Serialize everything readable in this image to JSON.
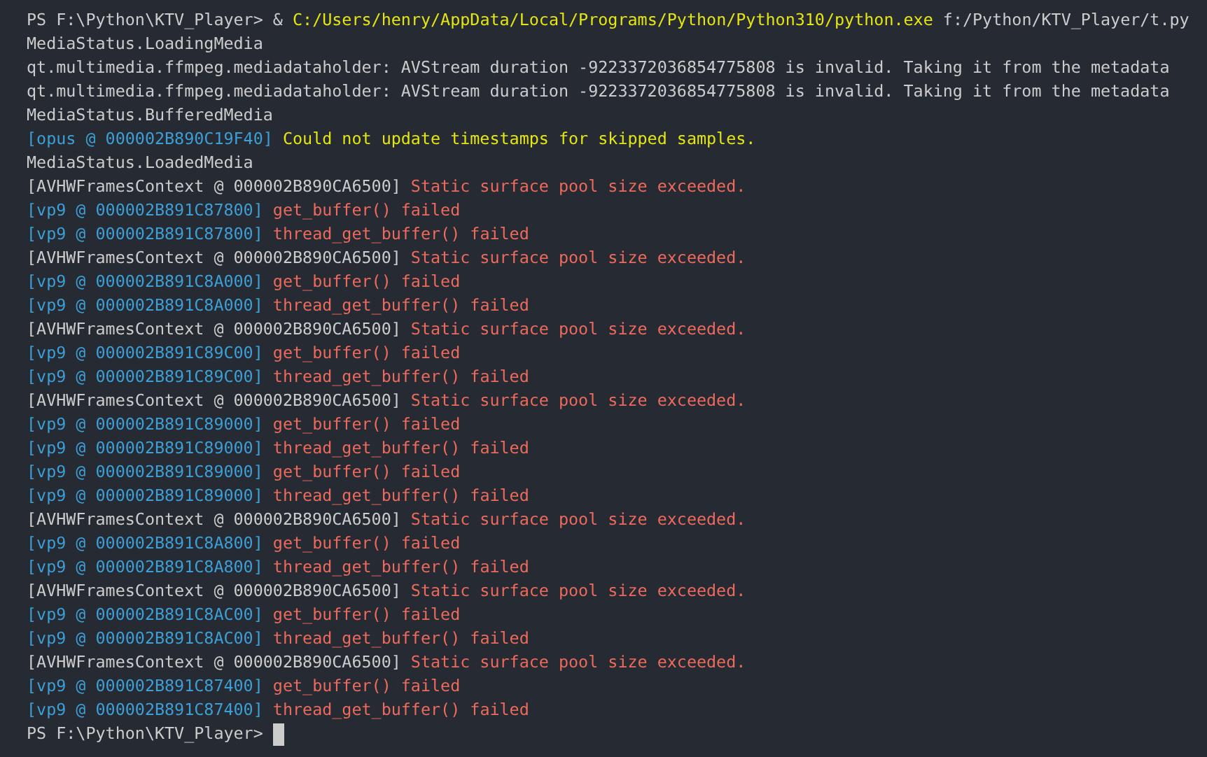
{
  "lines": [
    {
      "segments": [
        {
          "kind": "plain",
          "text": "PS F:\\Python\\KTV_Player>"
        },
        {
          "kind": "plain",
          "text": "&"
        },
        {
          "kind": "path",
          "text": "C:/Users/henry/AppData/Local/Programs/Python/Python310/python.exe"
        },
        {
          "kind": "plain",
          "text": "f:/Python/KTV_Player/t.py"
        }
      ]
    },
    {
      "segments": [
        {
          "kind": "plain",
          "text": "MediaStatus.LoadingMedia"
        }
      ]
    },
    {
      "segments": [
        {
          "kind": "plain",
          "text": "qt.multimedia.ffmpeg.mediadataholder: AVStream duration -9223372036854775808 is invalid. Taking it from the metadata"
        }
      ]
    },
    {
      "segments": [
        {
          "kind": "plain",
          "text": "qt.multimedia.ffmpeg.mediadataholder: AVStream duration -9223372036854775808 is invalid. Taking it from the metadata"
        }
      ]
    },
    {
      "segments": [
        {
          "kind": "plain",
          "text": "MediaStatus.BufferedMedia"
        }
      ]
    },
    {
      "segments": [
        {
          "kind": "source",
          "text": "[opus @ 000002B890C19F40]"
        },
        {
          "kind": "warning",
          "text": "Could not update timestamps for skipped samples."
        }
      ]
    },
    {
      "segments": [
        {
          "kind": "plain",
          "text": "MediaStatus.LoadedMedia"
        }
      ]
    },
    {
      "segments": [
        {
          "kind": "plain",
          "text": "[AVHWFramesContext @ 000002B890CA6500]"
        },
        {
          "kind": "error",
          "text": "Static surface pool size exceeded."
        }
      ]
    },
    {
      "segments": [
        {
          "kind": "source",
          "text": "[vp9 @ 000002B891C87800]"
        },
        {
          "kind": "error",
          "text": "get_buffer() failed"
        }
      ]
    },
    {
      "segments": [
        {
          "kind": "source",
          "text": "[vp9 @ 000002B891C87800]"
        },
        {
          "kind": "error",
          "text": "thread_get_buffer() failed"
        }
      ]
    },
    {
      "segments": [
        {
          "kind": "plain",
          "text": "[AVHWFramesContext @ 000002B890CA6500]"
        },
        {
          "kind": "error",
          "text": "Static surface pool size exceeded."
        }
      ]
    },
    {
      "segments": [
        {
          "kind": "source",
          "text": "[vp9 @ 000002B891C8A000]"
        },
        {
          "kind": "error",
          "text": "get_buffer() failed"
        }
      ]
    },
    {
      "segments": [
        {
          "kind": "source",
          "text": "[vp9 @ 000002B891C8A000]"
        },
        {
          "kind": "error",
          "text": "thread_get_buffer() failed"
        }
      ]
    },
    {
      "segments": [
        {
          "kind": "plain",
          "text": "[AVHWFramesContext @ 000002B890CA6500]"
        },
        {
          "kind": "error",
          "text": "Static surface pool size exceeded."
        }
      ]
    },
    {
      "segments": [
        {
          "kind": "source",
          "text": "[vp9 @ 000002B891C89C00]"
        },
        {
          "kind": "error",
          "text": "get_buffer() failed"
        }
      ]
    },
    {
      "segments": [
        {
          "kind": "source",
          "text": "[vp9 @ 000002B891C89C00]"
        },
        {
          "kind": "error",
          "text": "thread_get_buffer() failed"
        }
      ]
    },
    {
      "segments": [
        {
          "kind": "plain",
          "text": "[AVHWFramesContext @ 000002B890CA6500]"
        },
        {
          "kind": "error",
          "text": "Static surface pool size exceeded."
        }
      ]
    },
    {
      "segments": [
        {
          "kind": "source",
          "text": "[vp9 @ 000002B891C89000]"
        },
        {
          "kind": "error",
          "text": "get_buffer() failed"
        }
      ]
    },
    {
      "segments": [
        {
          "kind": "source",
          "text": "[vp9 @ 000002B891C89000]"
        },
        {
          "kind": "error",
          "text": "thread_get_buffer() failed"
        }
      ]
    },
    {
      "segments": [
        {
          "kind": "source",
          "text": "[vp9 @ 000002B891C89000]"
        },
        {
          "kind": "error",
          "text": "get_buffer() failed"
        }
      ]
    },
    {
      "segments": [
        {
          "kind": "source",
          "text": "[vp9 @ 000002B891C89000]"
        },
        {
          "kind": "error",
          "text": "thread_get_buffer() failed"
        }
      ]
    },
    {
      "segments": [
        {
          "kind": "plain",
          "text": "[AVHWFramesContext @ 000002B890CA6500]"
        },
        {
          "kind": "error",
          "text": "Static surface pool size exceeded."
        }
      ]
    },
    {
      "segments": [
        {
          "kind": "source",
          "text": "[vp9 @ 000002B891C8A800]"
        },
        {
          "kind": "error",
          "text": "get_buffer() failed"
        }
      ]
    },
    {
      "segments": [
        {
          "kind": "source",
          "text": "[vp9 @ 000002B891C8A800]"
        },
        {
          "kind": "error",
          "text": "thread_get_buffer() failed"
        }
      ]
    },
    {
      "segments": [
        {
          "kind": "plain",
          "text": "[AVHWFramesContext @ 000002B890CA6500]"
        },
        {
          "kind": "error",
          "text": "Static surface pool size exceeded."
        }
      ]
    },
    {
      "segments": [
        {
          "kind": "source",
          "text": "[vp9 @ 000002B891C8AC00]"
        },
        {
          "kind": "error",
          "text": "get_buffer() failed"
        }
      ]
    },
    {
      "segments": [
        {
          "kind": "source",
          "text": "[vp9 @ 000002B891C8AC00]"
        },
        {
          "kind": "error",
          "text": "thread_get_buffer() failed"
        }
      ]
    },
    {
      "segments": [
        {
          "kind": "plain",
          "text": "[AVHWFramesContext @ 000002B890CA6500]"
        },
        {
          "kind": "error",
          "text": "Static surface pool size exceeded."
        }
      ]
    },
    {
      "segments": [
        {
          "kind": "source",
          "text": "[vp9 @ 000002B891C87400]"
        },
        {
          "kind": "error",
          "text": "get_buffer() failed"
        }
      ]
    },
    {
      "segments": [
        {
          "kind": "source",
          "text": "[vp9 @ 000002B891C87400]"
        },
        {
          "kind": "error",
          "text": "thread_get_buffer() failed"
        }
      ]
    }
  ],
  "prompt": {
    "text": "PS F:\\Python\\KTV_Player>",
    "cursor": true
  }
}
